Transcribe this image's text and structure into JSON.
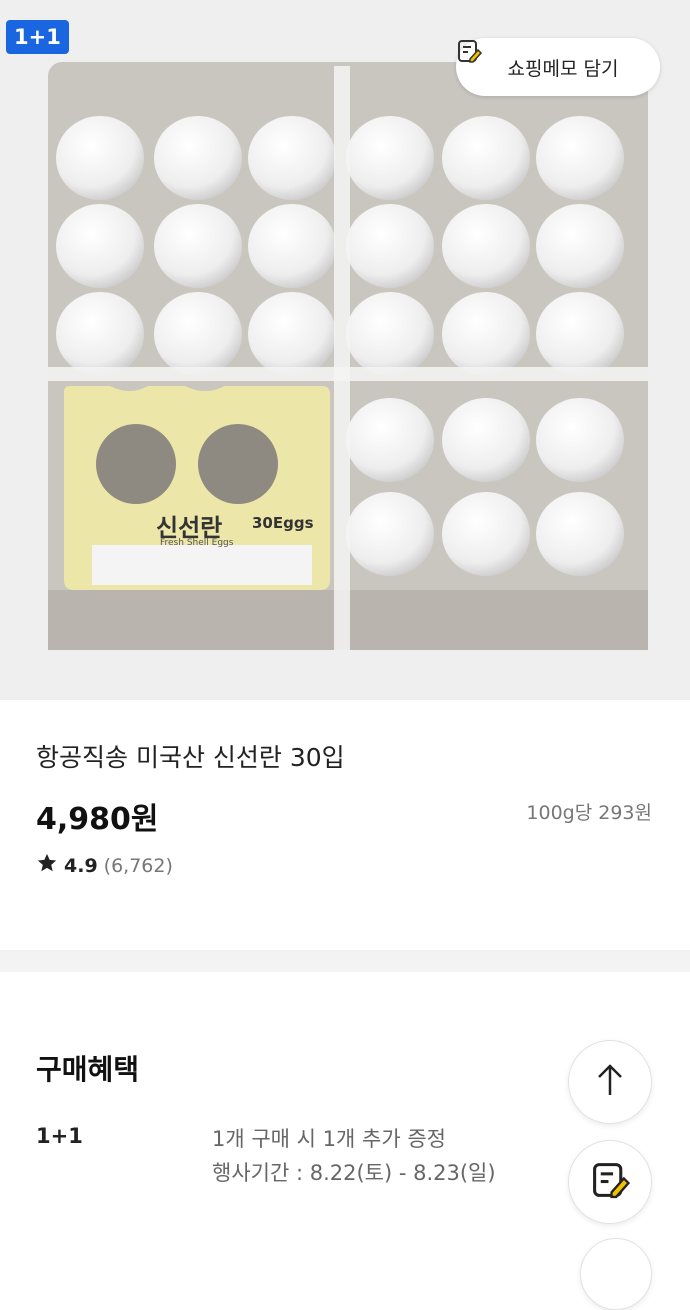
{
  "product_image": {
    "promo_badge": "1+1",
    "memo_button_label": "쇼핑메모 담기",
    "carton_label_title": "신선란",
    "carton_label_sub": "Fresh Shell Eggs",
    "carton_label_count": "30Eggs"
  },
  "product": {
    "title": "항공직송 미국산 신선란 30입",
    "price": "4,980원",
    "unit_price": "100g당 293원",
    "rating_score": "4.9",
    "rating_count": "(6,762)"
  },
  "benefits": {
    "heading": "구매혜택",
    "items": [
      {
        "label": "1+1",
        "line1": "1개 구매 시 1개 추가 증정",
        "line2": "행사기간 : 8.22(토) - 8.23(일)"
      }
    ]
  },
  "icons": {
    "memo": "memo-pencil-icon",
    "star": "star-icon",
    "scroll_top": "arrow-up-icon"
  },
  "colors": {
    "promo_badge": "#1a66e0",
    "memo_icon_accent": "#f2c200"
  }
}
